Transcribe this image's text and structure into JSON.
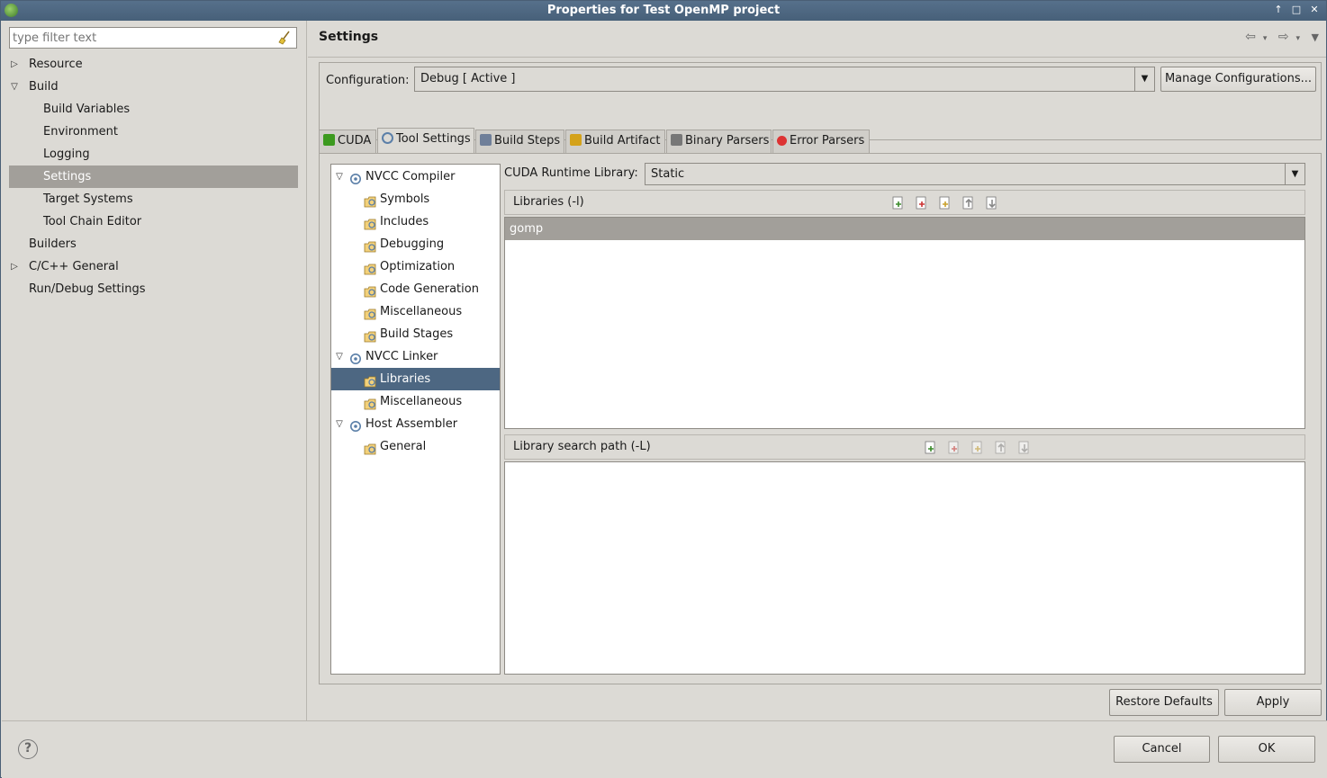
{
  "window": {
    "title": "Properties for Test OpenMP project"
  },
  "filter": {
    "placeholder": "type filter text"
  },
  "left_tree": [
    {
      "label": "Resource",
      "indent": 0,
      "twisty": "closed"
    },
    {
      "label": "Build",
      "indent": 0,
      "twisty": "open"
    },
    {
      "label": "Build Variables",
      "indent": 1,
      "twisty": ""
    },
    {
      "label": "Environment",
      "indent": 1,
      "twisty": ""
    },
    {
      "label": "Logging",
      "indent": 1,
      "twisty": ""
    },
    {
      "label": "Settings",
      "indent": 1,
      "twisty": "",
      "selected": true
    },
    {
      "label": "Target Systems",
      "indent": 1,
      "twisty": ""
    },
    {
      "label": "Tool Chain Editor",
      "indent": 1,
      "twisty": ""
    },
    {
      "label": "Builders",
      "indent": 0,
      "twisty": ""
    },
    {
      "label": "C/C++ General",
      "indent": 0,
      "twisty": "closed"
    },
    {
      "label": "Run/Debug Settings",
      "indent": 0,
      "twisty": ""
    }
  ],
  "page": {
    "title": "Settings"
  },
  "config": {
    "label": "Configuration:",
    "value": "Debug  [ Active ]",
    "manage_label": "Manage Configurations..."
  },
  "tabs": [
    {
      "label": "CUDA",
      "icon": "cuda-icon",
      "active": false
    },
    {
      "label": "Tool Settings",
      "icon": "tool-settings-icon",
      "active": true
    },
    {
      "label": "Build Steps",
      "icon": "build-steps-icon",
      "active": false
    },
    {
      "label": "Build Artifact",
      "icon": "build-artifact-icon",
      "active": false
    },
    {
      "label": "Binary Parsers",
      "icon": "binary-parsers-icon",
      "active": false
    },
    {
      "label": "Error Parsers",
      "icon": "error-parsers-icon",
      "active": false
    }
  ],
  "tool_tree": [
    {
      "label": "NVCC Compiler",
      "level": 0,
      "twisty": "open",
      "icon": "tool-icon"
    },
    {
      "label": "Symbols",
      "level": 1,
      "icon": "option-category-icon"
    },
    {
      "label": "Includes",
      "level": 1,
      "icon": "option-category-icon"
    },
    {
      "label": "Debugging",
      "level": 1,
      "icon": "option-category-icon"
    },
    {
      "label": "Optimization",
      "level": 1,
      "icon": "option-category-icon"
    },
    {
      "label": "Code Generation",
      "level": 1,
      "icon": "option-category-icon"
    },
    {
      "label": "Miscellaneous",
      "level": 1,
      "icon": "option-category-icon"
    },
    {
      "label": "Build Stages",
      "level": 1,
      "icon": "option-category-icon"
    },
    {
      "label": "NVCC Linker",
      "level": 0,
      "twisty": "open",
      "icon": "tool-icon"
    },
    {
      "label": "Libraries",
      "level": 1,
      "icon": "option-category-icon",
      "selected": true
    },
    {
      "label": "Miscellaneous",
      "level": 1,
      "icon": "option-category-icon"
    },
    {
      "label": "Host Assembler",
      "level": 0,
      "twisty": "open",
      "icon": "tool-icon"
    },
    {
      "label": "General",
      "level": 1,
      "icon": "option-category-icon"
    }
  ],
  "runtime": {
    "label": "CUDA Runtime Library:",
    "value": "Static"
  },
  "libraries": {
    "header": "Libraries (-l)",
    "items": [
      "gomp"
    ]
  },
  "search_path": {
    "header": "Library search path (-L)",
    "items": []
  },
  "list_tools": [
    "add-icon",
    "delete-icon",
    "edit-icon",
    "move-up-icon",
    "move-down-icon"
  ],
  "buttons": {
    "restore_defaults": "Restore Defaults",
    "apply": "Apply",
    "cancel": "Cancel",
    "ok": "OK"
  }
}
